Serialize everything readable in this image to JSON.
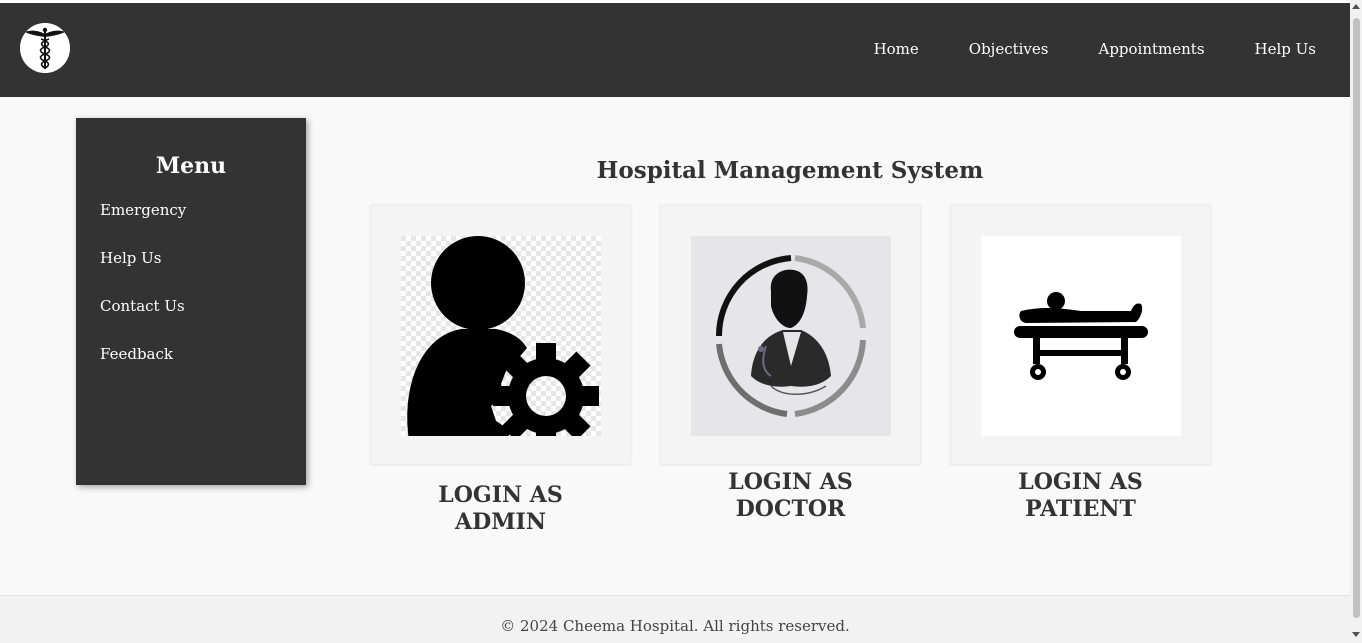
{
  "header": {
    "logo_icon": "caduceus-icon",
    "nav": [
      {
        "label": "Home"
      },
      {
        "label": "Objectives"
      },
      {
        "label": "Appointments"
      },
      {
        "label": "Help Us"
      }
    ]
  },
  "sidebar": {
    "title": "Menu",
    "items": [
      {
        "label": "Emergency"
      },
      {
        "label": "Help Us"
      },
      {
        "label": "Contact Us"
      },
      {
        "label": "Feedback"
      }
    ]
  },
  "main": {
    "title": "Hospital Management System",
    "cards": [
      {
        "label_line1": "LOGIN AS",
        "label_line2": "ADMIN",
        "icon": "admin-settings-icon"
      },
      {
        "label_line1": "LOGIN AS",
        "label_line2": "DOCTOR",
        "icon": "doctor-icon"
      },
      {
        "label_line1": "LOGIN AS",
        "label_line2": "PATIENT",
        "icon": "patient-stretcher-icon"
      }
    ]
  },
  "footer": {
    "text": "© 2024 Cheema Hospital. All rights reserved."
  },
  "colors": {
    "navbar_bg": "#333333",
    "sidebar_bg": "#333333",
    "page_bg": "#f9f9f9",
    "text_dark": "#333333"
  }
}
